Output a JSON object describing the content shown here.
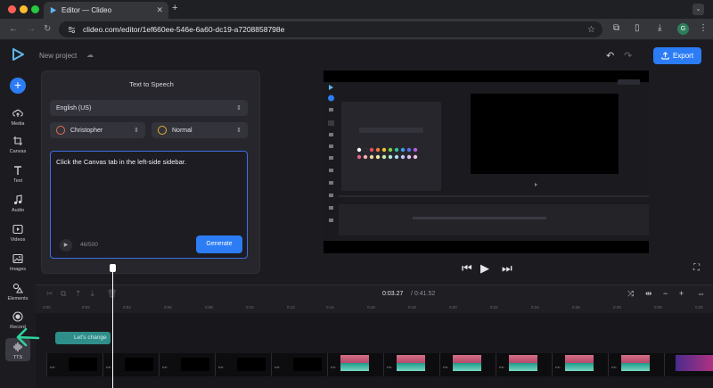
{
  "browser": {
    "tab_title": "Editor — Clideo",
    "url": "clideo.com/editor/1ef660ee-546e-6a60-dc19-a7208858798e",
    "avatar_letter": "G"
  },
  "app": {
    "project_name": "New project",
    "export_label": "Export"
  },
  "sidebar": {
    "items": [
      {
        "label": "Media",
        "icon": "cloud-upload-icon"
      },
      {
        "label": "Canvas",
        "icon": "canvas-icon"
      },
      {
        "label": "Text",
        "icon": "text-icon"
      },
      {
        "label": "Audio",
        "icon": "music-note-icon"
      },
      {
        "label": "Videos",
        "icon": "video-icon"
      },
      {
        "label": "Images",
        "icon": "image-icon"
      },
      {
        "label": "Elements",
        "icon": "shapes-icon"
      },
      {
        "label": "Record",
        "icon": "record-icon"
      },
      {
        "label": "TTS",
        "icon": "waveform-icon"
      }
    ]
  },
  "tts": {
    "title": "Text to Speech",
    "language": "English (US)",
    "voice": "Christopher",
    "style": "Normal",
    "text": "Click the Canvas tab in the left-side sidebar.",
    "count": "46/500",
    "generate_label": "Generate"
  },
  "timeline": {
    "current_time": "0:03.27",
    "total_time": "/ 0:41.52",
    "ticks": [
      "0:00",
      "0:02",
      "0:04",
      "0:06",
      "0:08",
      "0:10",
      "0:12",
      "0:14",
      "0:16",
      "0:18",
      "0:20",
      "0:22",
      "0:24",
      "0:26",
      "0:28",
      "0:30",
      "0:32"
    ],
    "audio_clip_label": "Let's change"
  },
  "colors": {
    "accent": "#2b7cf5",
    "audio_clip": "#2f8e8a"
  }
}
